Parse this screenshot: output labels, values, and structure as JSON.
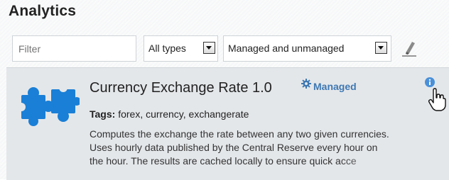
{
  "page": {
    "title": "Analytics"
  },
  "filters": {
    "search": {
      "placeholder": "Filter",
      "value": ""
    },
    "type_select": {
      "value": "All types"
    },
    "managed_select": {
      "value": "Managed and unmanaged"
    },
    "clear_icon": "eraser-icon"
  },
  "card": {
    "icon": "puzzle-piece-icon",
    "title": "Currency Exchange Rate 1.0",
    "badge_icon": "gear-icon",
    "badge_label": "Managed",
    "tags_label": "Tags:",
    "tags_value": "forex, currency, exchangerate",
    "description_lines": [
      "Computes the exchange the rate between any two given currencies.",
      "Uses hourly data published by the Central Reserve every hour on",
      "the hour. The results are cached locally to ensure quick acce"
    ],
    "info_icon": "info-icon",
    "cursor": "hand-pointer-cursor"
  },
  "colors": {
    "accent": "#3f78b2",
    "card_bg": "#e4e7ea",
    "puzzle": "#1a7fd6"
  }
}
